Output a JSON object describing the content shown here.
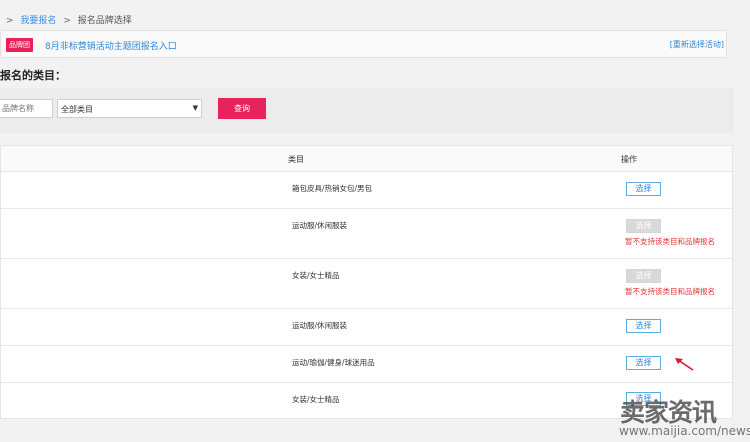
{
  "breadcrumb": {
    "sep1": ">",
    "link": "我要报名",
    "sep2": ">",
    "current": "报名品牌选择"
  },
  "banner": {
    "badge": "品牌团",
    "text": "8月非标营销活动主题团报名入口",
    "reselect": "[重新选择活动]"
  },
  "section_title": "报名的类目：",
  "filter": {
    "name_placeholder": "品牌名称",
    "category_value": "全部类目",
    "arrow": "▼",
    "query_label": "查询"
  },
  "table": {
    "headers": {
      "category": "类目",
      "operation": "操作"
    },
    "rows": [
      {
        "category": "箱包皮具/热销女包/男包",
        "button": "选择",
        "enabled": true,
        "note": ""
      },
      {
        "category": "运动服/休闲服装",
        "button": "选择",
        "enabled": false,
        "note": "暂不支持该类目和品牌报名"
      },
      {
        "category": "女装/女士精品",
        "button": "选择",
        "enabled": false,
        "note": "暂不支持该类目和品牌报名"
      },
      {
        "category": "运动服/休闲服装",
        "button": "选择",
        "enabled": true,
        "note": ""
      },
      {
        "category": "运动/瑜伽/健身/球迷用品",
        "button": "选择",
        "enabled": true,
        "note": ""
      },
      {
        "category": "女装/女士精品",
        "button": "选择",
        "enabled": true,
        "note": ""
      }
    ]
  },
  "watermark": {
    "main": "卖家资讯",
    "url": "www.maijia.com/news"
  },
  "colors": {
    "accent": "#e8235c",
    "link": "#2d86d8",
    "warning": "#e83535",
    "arrow": "#d9182b"
  }
}
